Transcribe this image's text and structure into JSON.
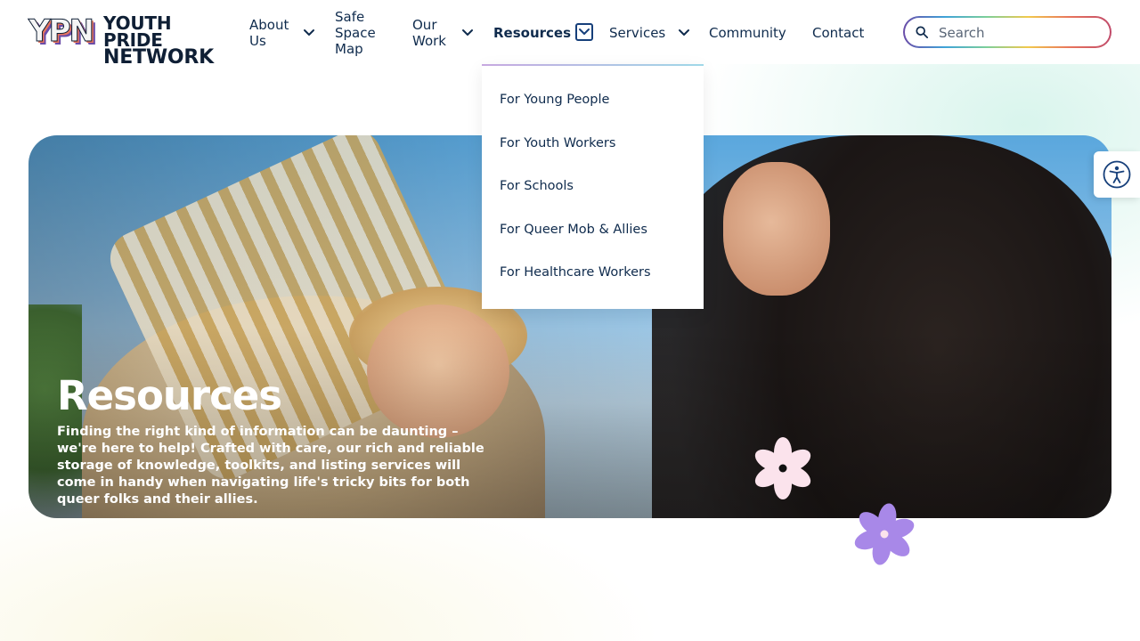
{
  "brand": {
    "logo_mark": "YPN",
    "logo_line1": "YOUTH PRIDE",
    "logo_line2": "NETWORK",
    "logo_colors": [
      "#e8745c",
      "#f2c94c",
      "#7ccf9a",
      "#3fa3d8",
      "#6b4ca8"
    ]
  },
  "nav": {
    "about_line1": "About",
    "about_line2": "Us",
    "safe_line1": "Safe",
    "safe_line2": "Space",
    "safe_line3": "Map",
    "work_line1": "Our",
    "work_line2": "Work",
    "resources": "Resources",
    "services": "Services",
    "community": "Community",
    "contact": "Contact"
  },
  "search": {
    "placeholder": "Search"
  },
  "dropdown": {
    "items": [
      "For Young People",
      "For Youth Workers",
      "For Schools",
      "For Queer Mob & Allies",
      "For Healthcare Workers"
    ]
  },
  "hero": {
    "title": "Resources",
    "description": "Finding the right kind of information can be daunting – we're here to help! Crafted with care, our rich and reliable storage of knowledge, toolkits, and listing services will come in handy when navigating life's tricky bits for both queer folks and their allies."
  },
  "colors": {
    "text": "#0f2b4d",
    "accent": "#163f7a",
    "flower_pink": "#fbe3ec",
    "flower_purple": "#a888e8"
  },
  "icons": [
    "search-icon",
    "chevron-down-icon",
    "accessibility-icon",
    "flower-decoration"
  ]
}
